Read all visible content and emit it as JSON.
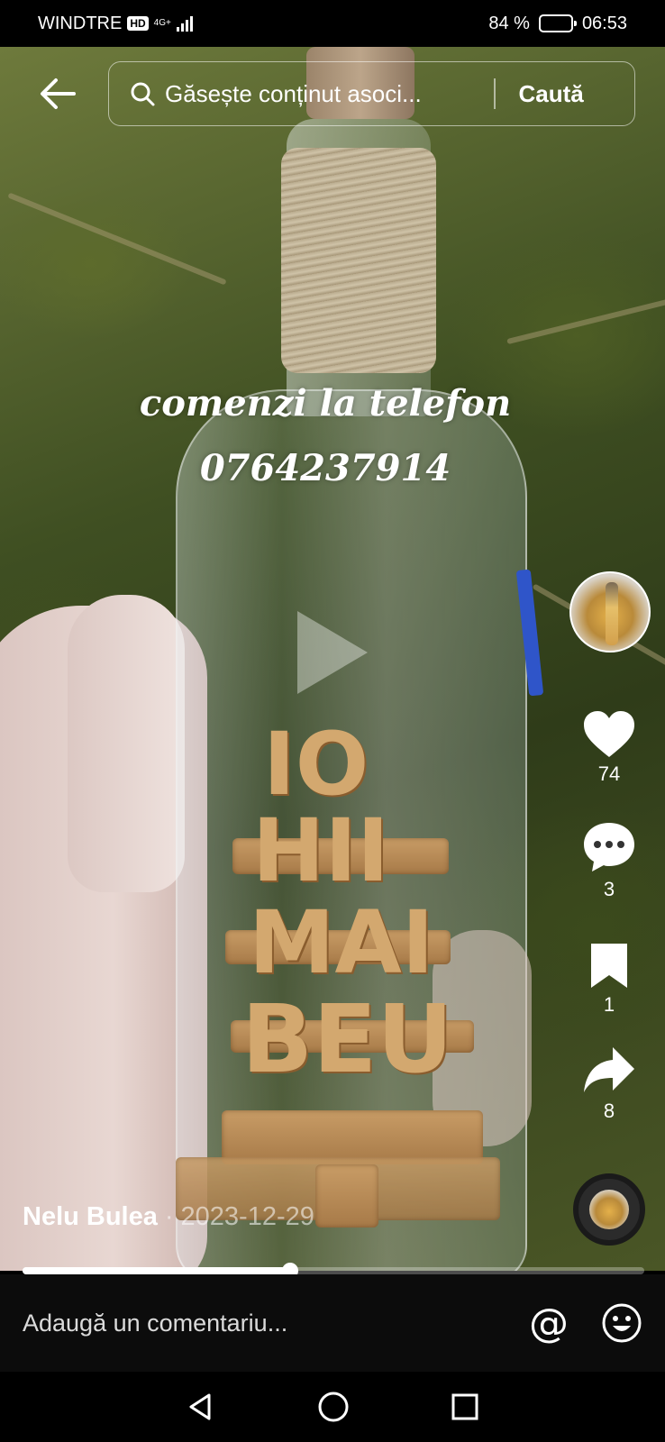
{
  "status_bar": {
    "carrier": "WINDTRE",
    "hd": "HD",
    "network": "4G+",
    "battery": "84 %",
    "battery_level": 0.84,
    "time": "06:53"
  },
  "search": {
    "placeholder": "Găsește conținut asoci...",
    "button_label": "Caută"
  },
  "video": {
    "overlay_line1": "comenzi la telefon",
    "overlay_line2": "0764237914",
    "author": "Nelu Bulea",
    "separator": "·",
    "date": "2023-12-29",
    "progress": 0.43
  },
  "actions": {
    "likes": "74",
    "comments": "3",
    "saves": "1",
    "shares": "8"
  },
  "comment_bar": {
    "placeholder": "Adaugă un comentariu...",
    "at_symbol": "@"
  },
  "icons": [
    "back-arrow-icon",
    "search-icon",
    "play-icon",
    "heart-icon",
    "comment-icon",
    "bookmark-icon",
    "share-icon",
    "emoji-icon",
    "nav-back-icon",
    "nav-home-icon",
    "nav-recents-icon"
  ]
}
